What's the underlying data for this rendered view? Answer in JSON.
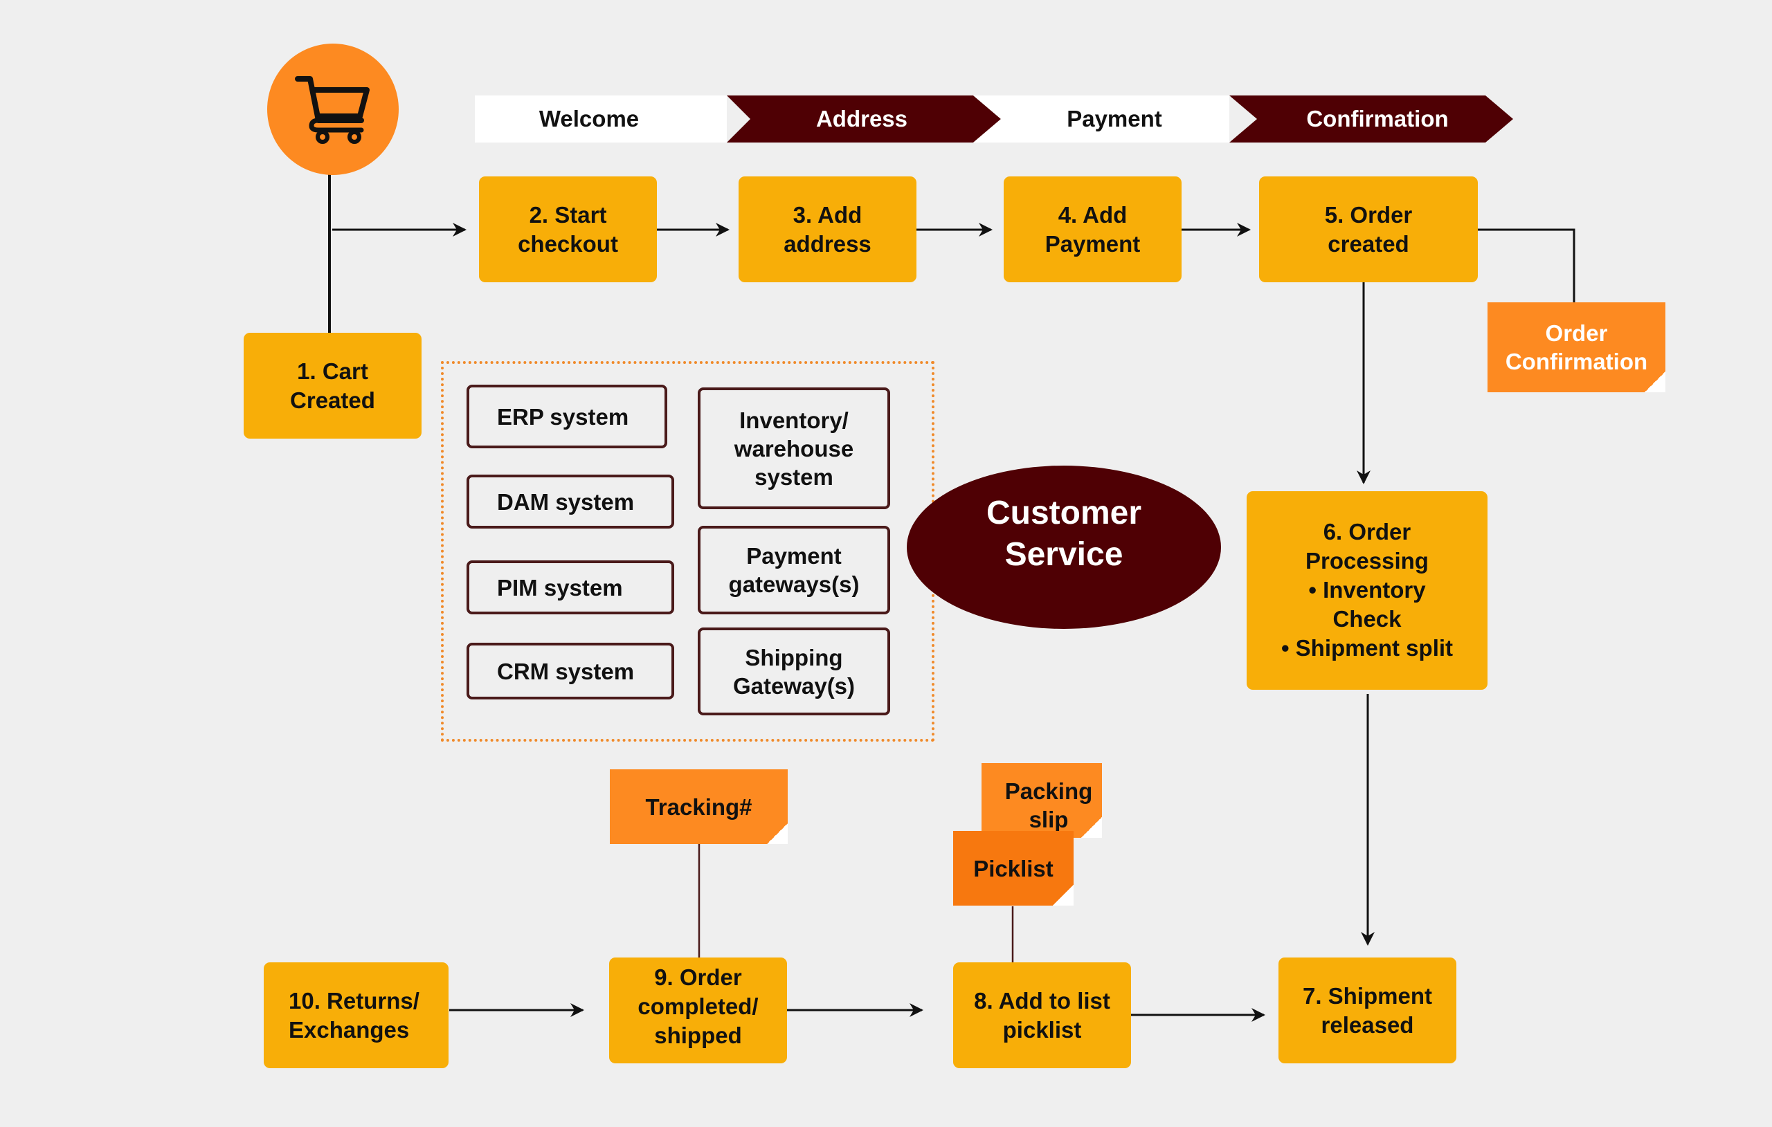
{
  "colors": {
    "background": "#efefef",
    "step_fill": "#f8ae08",
    "note_fill": "#fd8a21",
    "note_fill_dark": "#f7780f",
    "maroon": "#4f0004",
    "cart_circle": "#fd8a21",
    "dotted_border": "#f08a2a",
    "system_border": "#4a1a1a"
  },
  "start_icon": "shopping-cart-icon",
  "phases": [
    {
      "label": "Welcome",
      "style": "light"
    },
    {
      "label": "Address",
      "style": "dark"
    },
    {
      "label": "Payment",
      "style": "light"
    },
    {
      "label": "Confirmation",
      "style": "dark"
    }
  ],
  "steps": {
    "s1": "1. Cart\nCreated",
    "s2": "2. Start\ncheckout",
    "s3": "3. Add\naddress",
    "s4": "4. Add\nPayment",
    "s5": "5. Order\ncreated",
    "s6": "6. Order\nProcessing\n• Inventory\nCheck\n• Shipment split",
    "s7": "7. Shipment\nreleased",
    "s8": "8. Add to list\npicklist",
    "s9": "9. Order\ncompleted/\nshipped",
    "s10": "10. Returns/\nExchanges"
  },
  "notes": {
    "order_confirmation": "Order\nConfirmation",
    "tracking": "Tracking#",
    "packing_slip": "Packing\nslip",
    "picklist": "Picklist"
  },
  "systems": {
    "erp": "ERP system",
    "dam": "DAM system",
    "pim": "PIM system",
    "crm": "CRM system",
    "inventory": "Inventory/\nwarehouse\nsystem",
    "payment": "Payment\ngateways(s)",
    "shipping": "Shipping\nGateway(s)"
  },
  "customer_service": "Customer\nService"
}
